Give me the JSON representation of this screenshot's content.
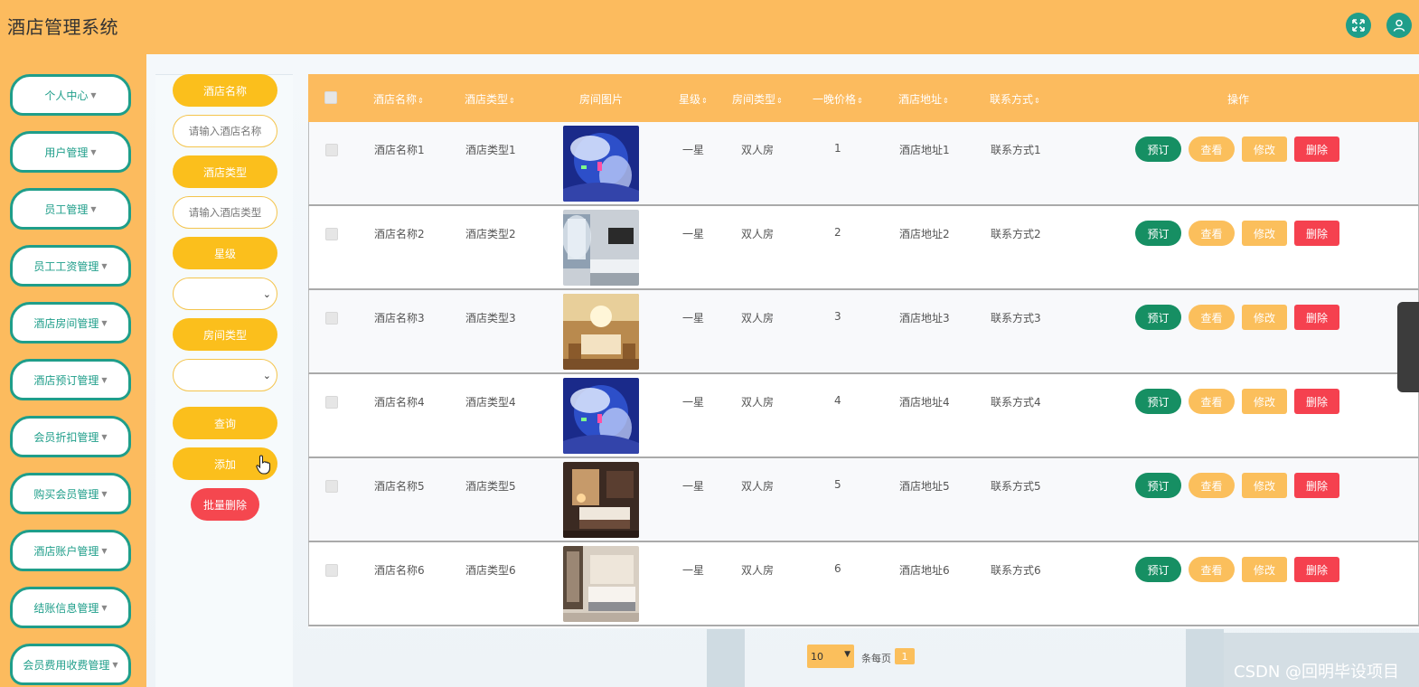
{
  "header": {
    "title": "酒店管理系统",
    "fullscreen_icon": "fullscreen-icon",
    "user_icon": "user-icon"
  },
  "sidebar": {
    "items": [
      {
        "label": "个人中心"
      },
      {
        "label": "用户管理"
      },
      {
        "label": "员工管理"
      },
      {
        "label": "员工工资管理"
      },
      {
        "label": "酒店房间管理"
      },
      {
        "label": "酒店预订管理"
      },
      {
        "label": "会员折扣管理"
      },
      {
        "label": "购买会员管理"
      },
      {
        "label": "酒店账户管理"
      },
      {
        "label": "结账信息管理"
      },
      {
        "label": "会员费用收费管理"
      }
    ]
  },
  "search": {
    "name_label": "酒店名称",
    "name_placeholder": "请输入酒店名称",
    "type_label": "酒店类型",
    "type_placeholder": "请输入酒店类型",
    "star_label": "星级",
    "room_type_label": "房间类型",
    "query_button": "查询",
    "add_button": "添加",
    "batch_delete_button": "批量删除"
  },
  "table": {
    "columns": [
      "酒店名称",
      "酒店类型",
      "房间图片",
      "星级",
      "房间类型",
      "一晚价格",
      "酒店地址",
      "联系方式",
      "操作"
    ],
    "actions": {
      "book": "预订",
      "view": "查看",
      "edit": "修改",
      "delete": "删除"
    },
    "rows": [
      {
        "name": "酒店名称1",
        "type": "酒店类型1",
        "star": "一星",
        "room_type": "双人房",
        "price": "1",
        "address": "酒店地址1",
        "contact": "联系方式1",
        "image": "blue-neon-room"
      },
      {
        "name": "酒店名称2",
        "type": "酒店类型2",
        "star": "一星",
        "room_type": "双人房",
        "price": "2",
        "address": "酒店地址2",
        "contact": "联系方式2",
        "image": "modern-window-room"
      },
      {
        "name": "酒店名称3",
        "type": "酒店类型3",
        "star": "一星",
        "room_type": "双人房",
        "price": "3",
        "address": "酒店地址3",
        "contact": "联系方式3",
        "image": "golden-classic-room"
      },
      {
        "name": "酒店名称4",
        "type": "酒店类型4",
        "star": "一星",
        "room_type": "双人房",
        "price": "4",
        "address": "酒店地址4",
        "contact": "联系方式4",
        "image": "blue-neon-room"
      },
      {
        "name": "酒店名称5",
        "type": "酒店类型5",
        "star": "一星",
        "room_type": "双人房",
        "price": "5",
        "address": "酒店地址5",
        "contact": "联系方式5",
        "image": "dark-wood-room"
      },
      {
        "name": "酒店名称6",
        "type": "酒店类型6",
        "star": "一星",
        "room_type": "双人房",
        "price": "6",
        "address": "酒店地址6",
        "contact": "联系方式6",
        "image": "beige-suite-room"
      }
    ]
  },
  "pagination": {
    "page_size": "10",
    "per_page_label": "条每页",
    "current_page": "1"
  },
  "watermark": "CSDN @回明毕设项目",
  "colors": {
    "primary": "#fcbb5e",
    "teal": "#1f9e8a",
    "label_yellow": "#fbbf1c",
    "book_green": "#168f63",
    "danger_red": "#f5414f"
  }
}
